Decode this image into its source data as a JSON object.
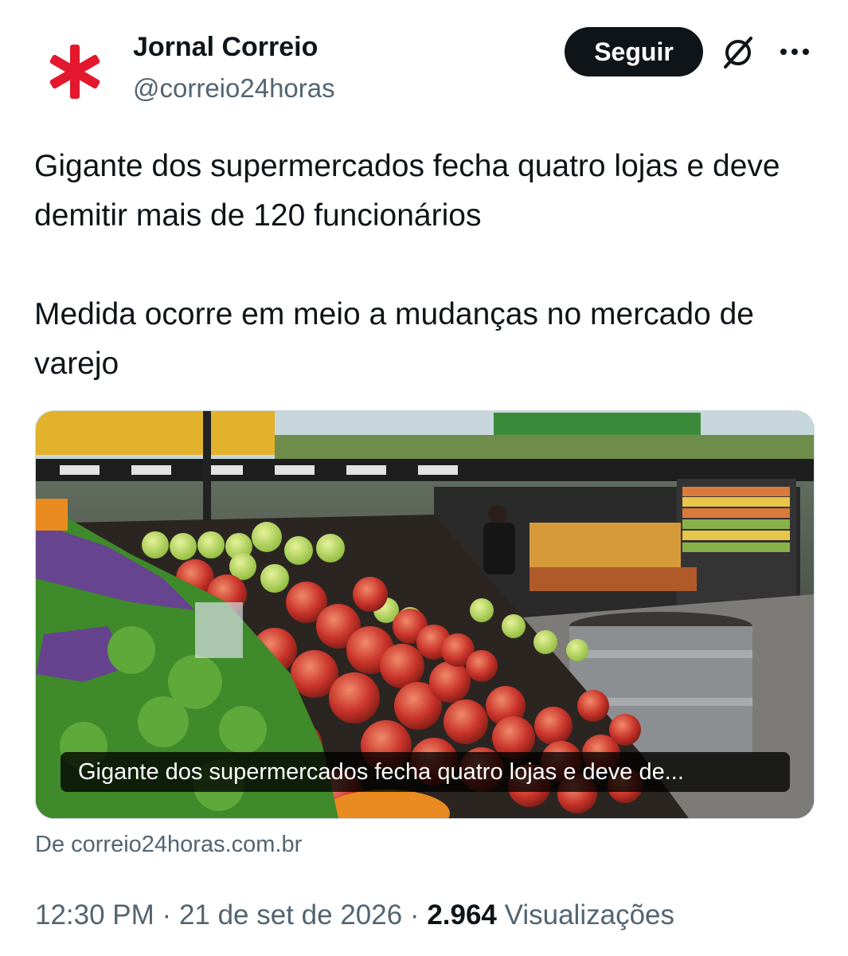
{
  "account": {
    "name": "Jornal Correio",
    "handle": "@correio24horas",
    "avatar_icon": "red-asterisk-icon",
    "brand_color": "#e3172d"
  },
  "actions": {
    "follow_label": "Seguir",
    "grok_icon": "grok-icon",
    "more_icon": "more-icon"
  },
  "post": {
    "paragraph1": "Gigante dos supermercados fecha quatro lojas e deve demitir mais de 120 funcionários",
    "paragraph2": "Medida ocorre em meio a mudanças no mercado de varejo"
  },
  "link_card": {
    "image_description": "supermarket produce section with apples",
    "title": "Gigante dos supermercados fecha quatro lojas e deve de...",
    "source": "De correio24horas.com.br"
  },
  "meta": {
    "time": "12:30 PM",
    "separator": "·",
    "date": "21 de set de 2026",
    "views_count": "2.964",
    "views_label": "Visualizações"
  }
}
